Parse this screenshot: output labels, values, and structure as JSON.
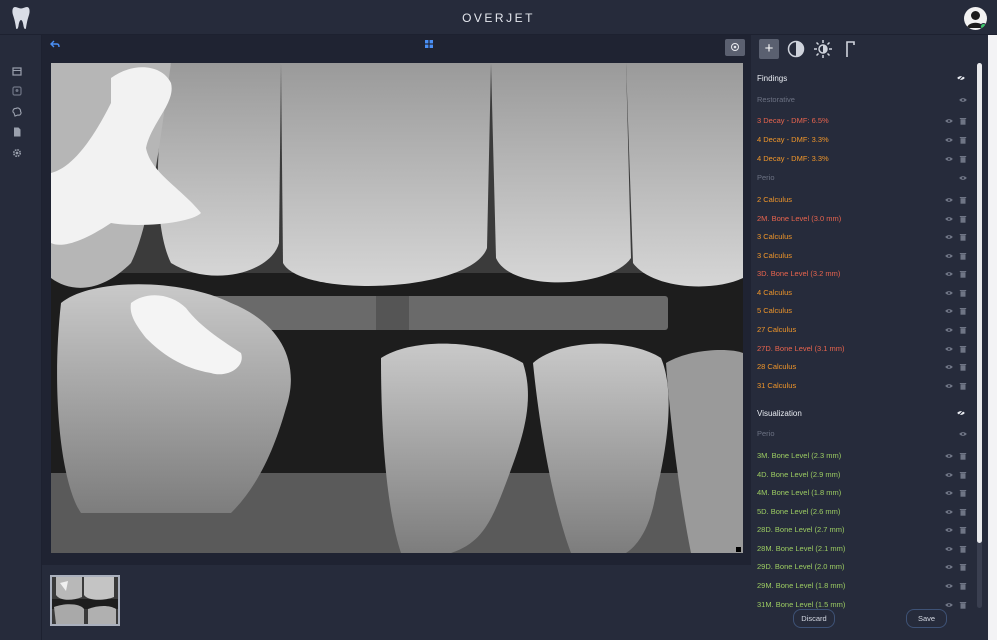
{
  "app": {
    "title": "OVERJET"
  },
  "icons": {
    "logo": "tooth-logo-icon",
    "avatar": "user-avatar-icon",
    "undo": "undo-arrow-icon",
    "grid": "grid-view-icon",
    "target": "target-icon",
    "add": "plus-icon",
    "contrast": "contrast-icon",
    "brightness": "brightness-icon",
    "gamma": "gamma-icon",
    "eye": "eye-icon",
    "trash": "trash-icon"
  },
  "nav": [
    "calendar-icon",
    "patients-icon",
    "brain-icon",
    "document-icon",
    "settings-icon"
  ],
  "panel": {
    "tools": {
      "add_label": "+"
    },
    "findings": {
      "title": "Findings",
      "groups": [
        {
          "name": "Restorative",
          "items": [
            {
              "label": "3 Decay - DMF: 6.5%",
              "color": "red"
            },
            {
              "label": "4 Decay - DMF: 3.3%",
              "color": "orange"
            },
            {
              "label": "4 Decay - DMF: 3.3%",
              "color": "orange"
            }
          ]
        },
        {
          "name": "Perio",
          "items": [
            {
              "label": "2 Calculus",
              "color": "orange"
            },
            {
              "label": "2M. Bone Level (3.0 mm)",
              "color": "red"
            },
            {
              "label": "3 Calculus",
              "color": "orange"
            },
            {
              "label": "3 Calculus",
              "color": "orange"
            },
            {
              "label": "3D. Bone Level (3.2 mm)",
              "color": "red"
            },
            {
              "label": "4 Calculus",
              "color": "orange"
            },
            {
              "label": "5 Calculus",
              "color": "orange"
            },
            {
              "label": "27 Calculus",
              "color": "orange"
            },
            {
              "label": "27D. Bone Level (3.1 mm)",
              "color": "red"
            },
            {
              "label": "28 Calculus",
              "color": "orange"
            },
            {
              "label": "31 Calculus",
              "color": "orange"
            }
          ]
        }
      ]
    },
    "visualization": {
      "title": "Visualization",
      "groups": [
        {
          "name": "Perio",
          "items": [
            {
              "label": "3M. Bone Level (2.3 mm)",
              "color": "green"
            },
            {
              "label": "4D. Bone Level (2.9 mm)",
              "color": "green"
            },
            {
              "label": "4M. Bone Level (1.8 mm)",
              "color": "green"
            },
            {
              "label": "5D. Bone Level (2.6 mm)",
              "color": "green"
            },
            {
              "label": "28D. Bone Level (2.7 mm)",
              "color": "green"
            },
            {
              "label": "28M. Bone Level (2.1 mm)",
              "color": "green"
            },
            {
              "label": "29D. Bone Level (2.0 mm)",
              "color": "green"
            },
            {
              "label": "29M. Bone Level (1.8 mm)",
              "color": "green"
            },
            {
              "label": "31M. Bone Level (1.5 mm)",
              "color": "green"
            }
          ]
        }
      ]
    },
    "buttons": {
      "discard": "Discard",
      "save": "Save"
    }
  },
  "colors": {
    "red": "#e8644e",
    "orange": "#f0962a",
    "green": "#9ccc62",
    "accent": "#3d8af7"
  }
}
